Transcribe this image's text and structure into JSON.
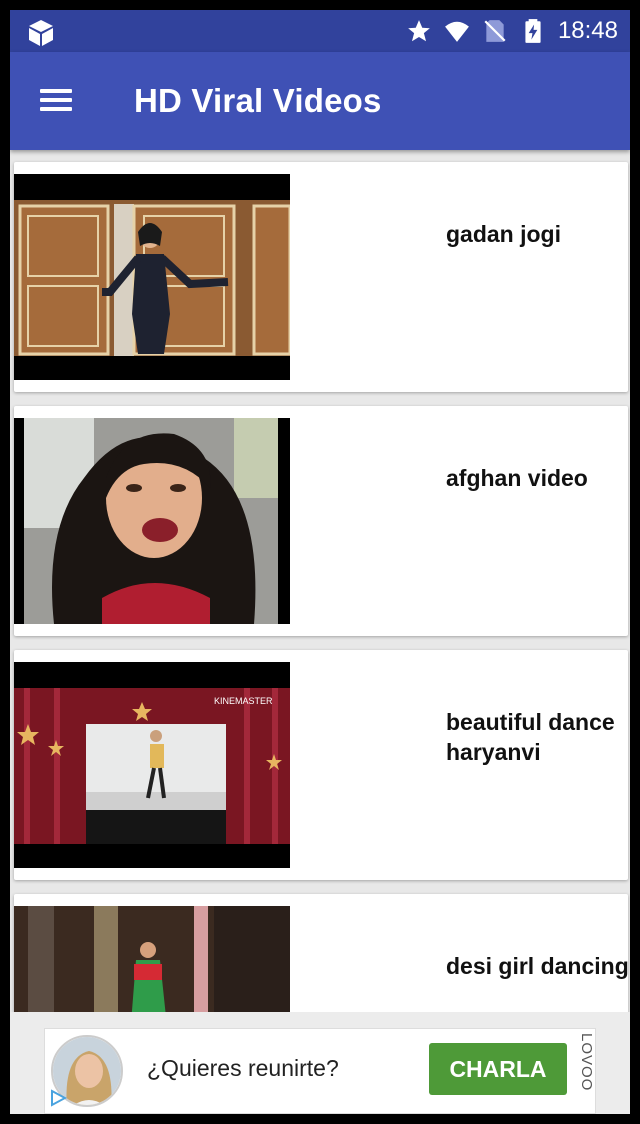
{
  "status_bar": {
    "time": "18:48",
    "icons": [
      "app-box-icon",
      "star-icon",
      "wifi-icon",
      "no-sim-icon",
      "battery-charging-icon"
    ]
  },
  "app_bar": {
    "title": "HD Viral Videos",
    "menu_icon": "hamburger-menu-icon"
  },
  "videos": [
    {
      "title": "gadan jogi"
    },
    {
      "title": "afghan video"
    },
    {
      "title": "beautiful dance haryanvi"
    },
    {
      "title": "desi girl dancing"
    }
  ],
  "thumb_overlays": {
    "watermark": "KINEMASTER"
  },
  "ad": {
    "text": "¿Quieres reunirte?",
    "button_label": "CHARLA",
    "brand": "LOVOO"
  },
  "colors": {
    "status_bar": "#31429c",
    "app_bar": "#3f51b5",
    "ad_button": "#4e9a38",
    "background": "#e8e8e8"
  }
}
